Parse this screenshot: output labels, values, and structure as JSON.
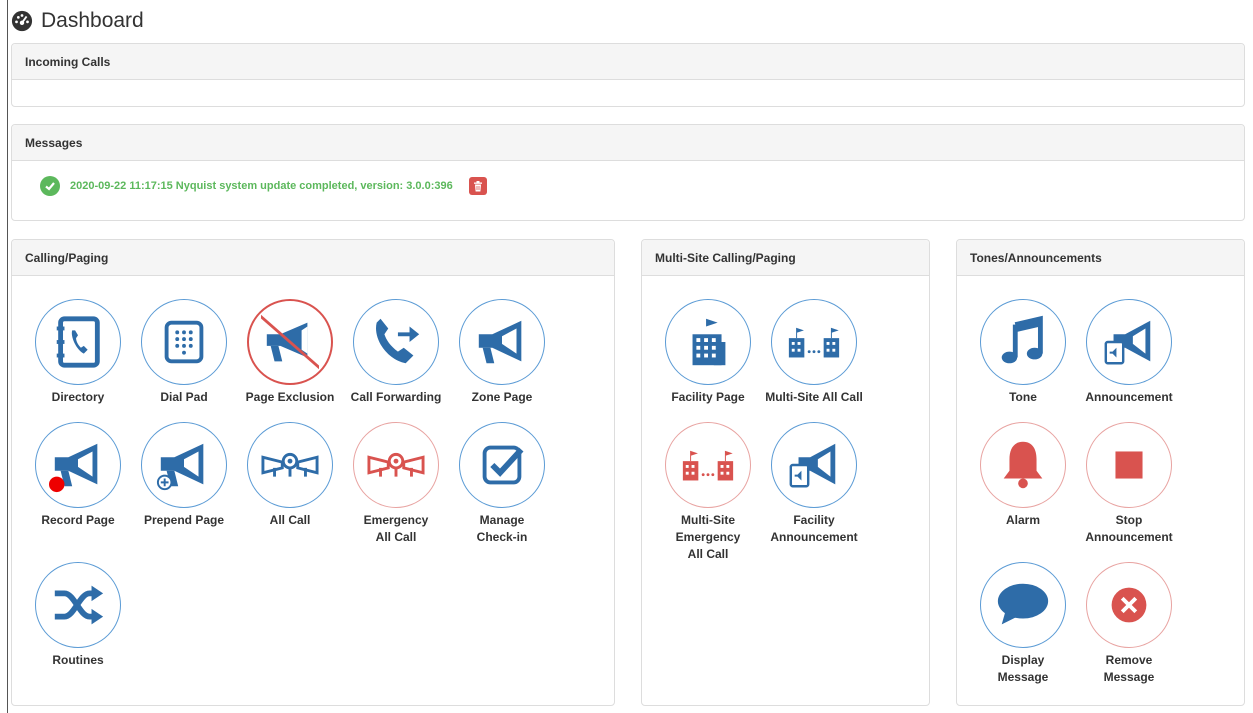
{
  "page": {
    "title": "Dashboard",
    "icon": "dashboard-gauge-icon"
  },
  "incoming_calls": {
    "title": "Incoming Calls"
  },
  "messages": {
    "title": "Messages",
    "items": [
      {
        "text": "2020-09-22 11:17:15 Nyquist system update completed, version: 3.0.0:396",
        "status": "success",
        "status_icon": "check-circle-icon",
        "delete_icon": "trash-icon"
      }
    ]
  },
  "calling_paging": {
    "title": "Calling/Paging",
    "tiles": [
      {
        "label": "Directory",
        "icon": "address-book-icon"
      },
      {
        "label": "Dial Pad",
        "icon": "dialpad-icon"
      },
      {
        "label": "Page Exclusion",
        "icon": "megaphone-prohibited-icon"
      },
      {
        "label": "Call Forwarding",
        "icon": "phone-forward-icon"
      },
      {
        "label": "Zone Page",
        "icon": "megaphone-icon"
      },
      {
        "label": "Record Page",
        "icon": "megaphone-record-icon"
      },
      {
        "label": "Prepend Page",
        "icon": "megaphone-plus-icon"
      },
      {
        "label": "All Call",
        "icon": "all-call-icon"
      },
      {
        "label_lines": [
          "Emergency",
          "All Call"
        ],
        "icon": "emergency-all-call-icon"
      },
      {
        "label_lines": [
          "Manage",
          "Check-in"
        ],
        "icon": "checkbox-icon"
      },
      {
        "label": "Routines",
        "icon": "shuffle-icon"
      }
    ]
  },
  "multi_site": {
    "title": "Multi-Site Calling/Paging",
    "tiles": [
      {
        "label": "Facility Page",
        "icon": "building-icon"
      },
      {
        "label": "Multi-Site All Call",
        "icon": "multi-building-icon"
      },
      {
        "label_lines": [
          "Multi-Site",
          "Emergency",
          "All Call"
        ],
        "icon": "multi-building-emergency-icon"
      },
      {
        "label_lines": [
          "Facility",
          "Announcement"
        ],
        "icon": "megaphone-file-icon"
      }
    ]
  },
  "tones": {
    "title": "Tones/Announcements",
    "tiles": [
      {
        "label": "Tone",
        "icon": "music-note-icon"
      },
      {
        "label": "Announcement",
        "icon": "megaphone-file-icon"
      },
      {
        "label": "Alarm",
        "icon": "bell-icon"
      },
      {
        "label_lines": [
          "Stop",
          "Announcement"
        ],
        "icon": "stop-icon"
      },
      {
        "label_lines": [
          "Display",
          "Message"
        ],
        "icon": "speech-bubble-icon"
      },
      {
        "label_lines": [
          "Remove",
          "Message"
        ],
        "icon": "close-circle-icon"
      }
    ]
  },
  "colors": {
    "primary_blue": "#2e6ca8",
    "danger_red": "#d9534f",
    "success_green": "#5cb85c",
    "panel_head": "#f5f5f5"
  }
}
